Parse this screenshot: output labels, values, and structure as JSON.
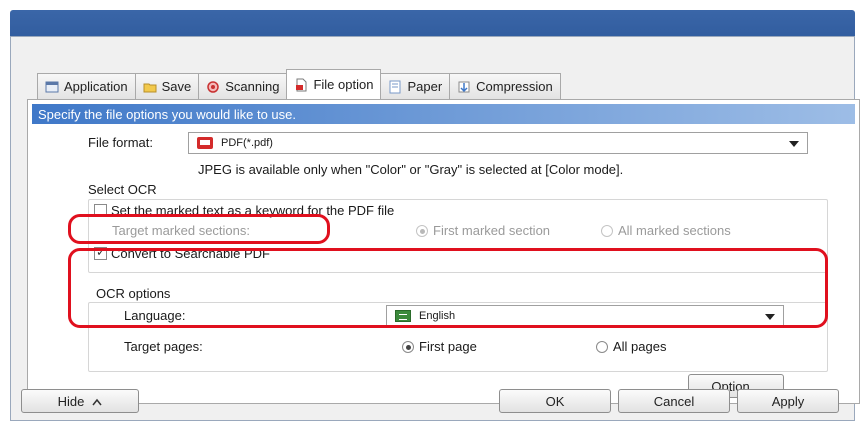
{
  "tabs": [
    {
      "label": "Application",
      "icon": "application-icon"
    },
    {
      "label": "Save",
      "icon": "folder-icon"
    },
    {
      "label": "Scanning",
      "icon": "scanning-icon"
    },
    {
      "label": "File option",
      "icon": "file-icon",
      "active": true
    },
    {
      "label": "Paper",
      "icon": "paper-icon"
    },
    {
      "label": "Compression",
      "icon": "compression-icon"
    }
  ],
  "banner": "Specify the file options you would like to use.",
  "file_format": {
    "label": "File format:",
    "value": "PDF(*.pdf)",
    "note": "JPEG is available only when \"Color\" or \"Gray\" is selected at [Color mode]."
  },
  "select_ocr": {
    "title": "Select OCR",
    "keyword_checkbox": "Set the marked text as a keyword for the PDF file",
    "target_label": "Target marked sections:",
    "radio_first": "First marked section",
    "radio_all": "All marked sections",
    "convert_checkbox": "Convert to Searchable PDF"
  },
  "ocr_options": {
    "title": "OCR options",
    "language_label": "Language:",
    "language_value": "English",
    "target_pages_label": "Target pages:",
    "radio_first_page": "First page",
    "radio_all_pages": "All pages",
    "option_button": "Option..."
  },
  "footer": {
    "hide_button": "Hide",
    "ok_button": "OK",
    "cancel_button": "Cancel",
    "apply_button": "Apply"
  },
  "colors": {
    "banner": "#3f78c8",
    "highlight": "#e0101e",
    "title_bar": "#2f5a9c"
  }
}
